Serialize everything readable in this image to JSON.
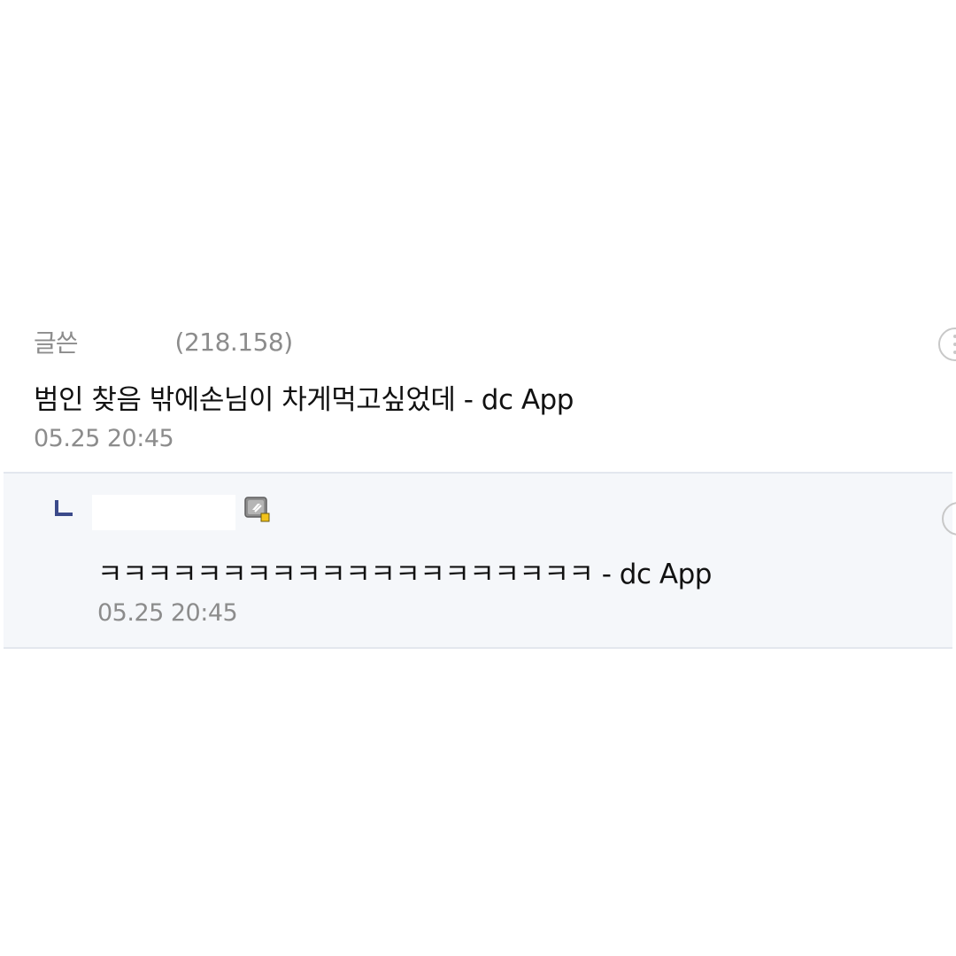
{
  "comment": {
    "author_label": "글쓴",
    "author_ip": "(218.158)",
    "text": "범인 찾음 밖에손님이 차게먹고싶었데 - dc App",
    "date": "05.25 20:45"
  },
  "reply": {
    "text": "ㅋㅋㅋㅋㅋㅋㅋㅋㅋㅋㅋㅋㅋㅋㅋㅋㅋㅋㅋㅋ - dc App",
    "date": "05.25 20:45"
  },
  "icons": {
    "more": "more-options-icon",
    "reply_arrow": "reply-arrow-icon",
    "fixed_nick": "fixed-nickname-icon"
  },
  "colors": {
    "reply_background": "#f5f7fa",
    "divider": "#e3e7ee",
    "meta_text": "#8c8c8c",
    "reply_arrow": "#3b4a8a"
  }
}
